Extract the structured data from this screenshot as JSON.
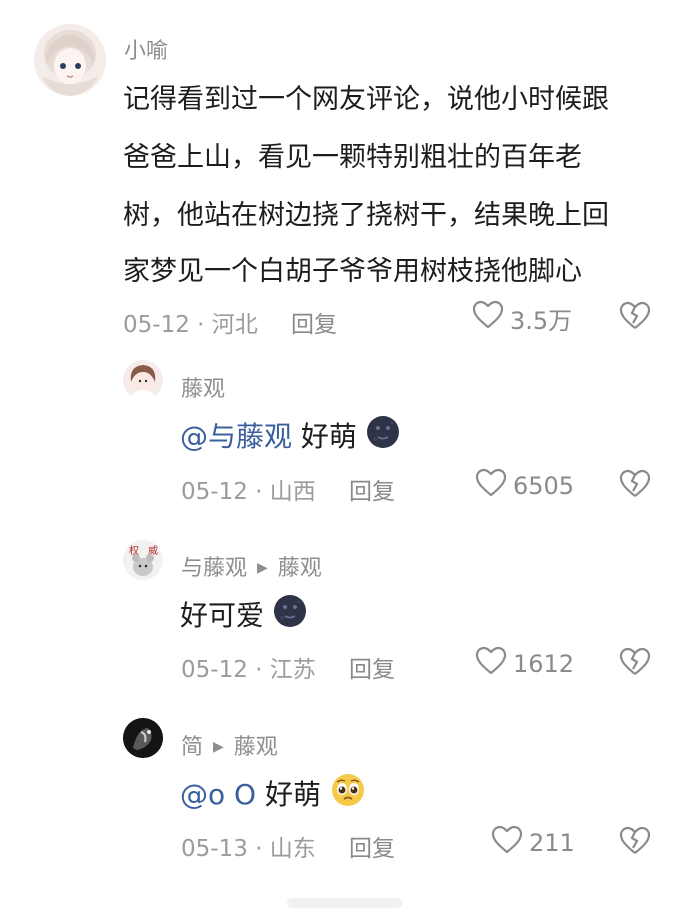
{
  "comments": [
    {
      "user": "小喻",
      "lines": [
        "记得看到过一个网友评论，说他小时候跟",
        "爸爸上山，看见一颗特别粗壮的百年老",
        "树，他站在树边挠了挠树干，结果晚上回",
        "家梦见一个白胡子爷爷用树枝挠他脚心"
      ],
      "meta": "05-12 · 河北",
      "reply": "回复",
      "likes": "3.5万"
    },
    {
      "user": "藤观",
      "mention": "@与藤观",
      "text": " 好萌",
      "meta": "05-12 · 山西",
      "reply": "回复",
      "likes": "6505"
    },
    {
      "user": "与藤观",
      "reply_to": "藤观",
      "text": "好可爱",
      "meta": "05-12 · 江苏",
      "reply": "回复",
      "likes": "1612"
    },
    {
      "user": "简",
      "reply_to": "藤观",
      "mention": "@o O",
      "text": " 好萌",
      "meta": "05-13 · 山东",
      "reply": "回复",
      "likes": "211"
    }
  ],
  "icons": {
    "like": "heart-outline-icon",
    "dislike": "broken-heart-icon",
    "reply_arrow": "triangle-right-icon",
    "emoji_dark": "dark-moon-face-emoji",
    "emoji_pleading": "pleading-face-emoji"
  },
  "colors": {
    "mention": "#3a5f9c",
    "meta": "#9b9b9b",
    "text": "#1d1d1d"
  }
}
